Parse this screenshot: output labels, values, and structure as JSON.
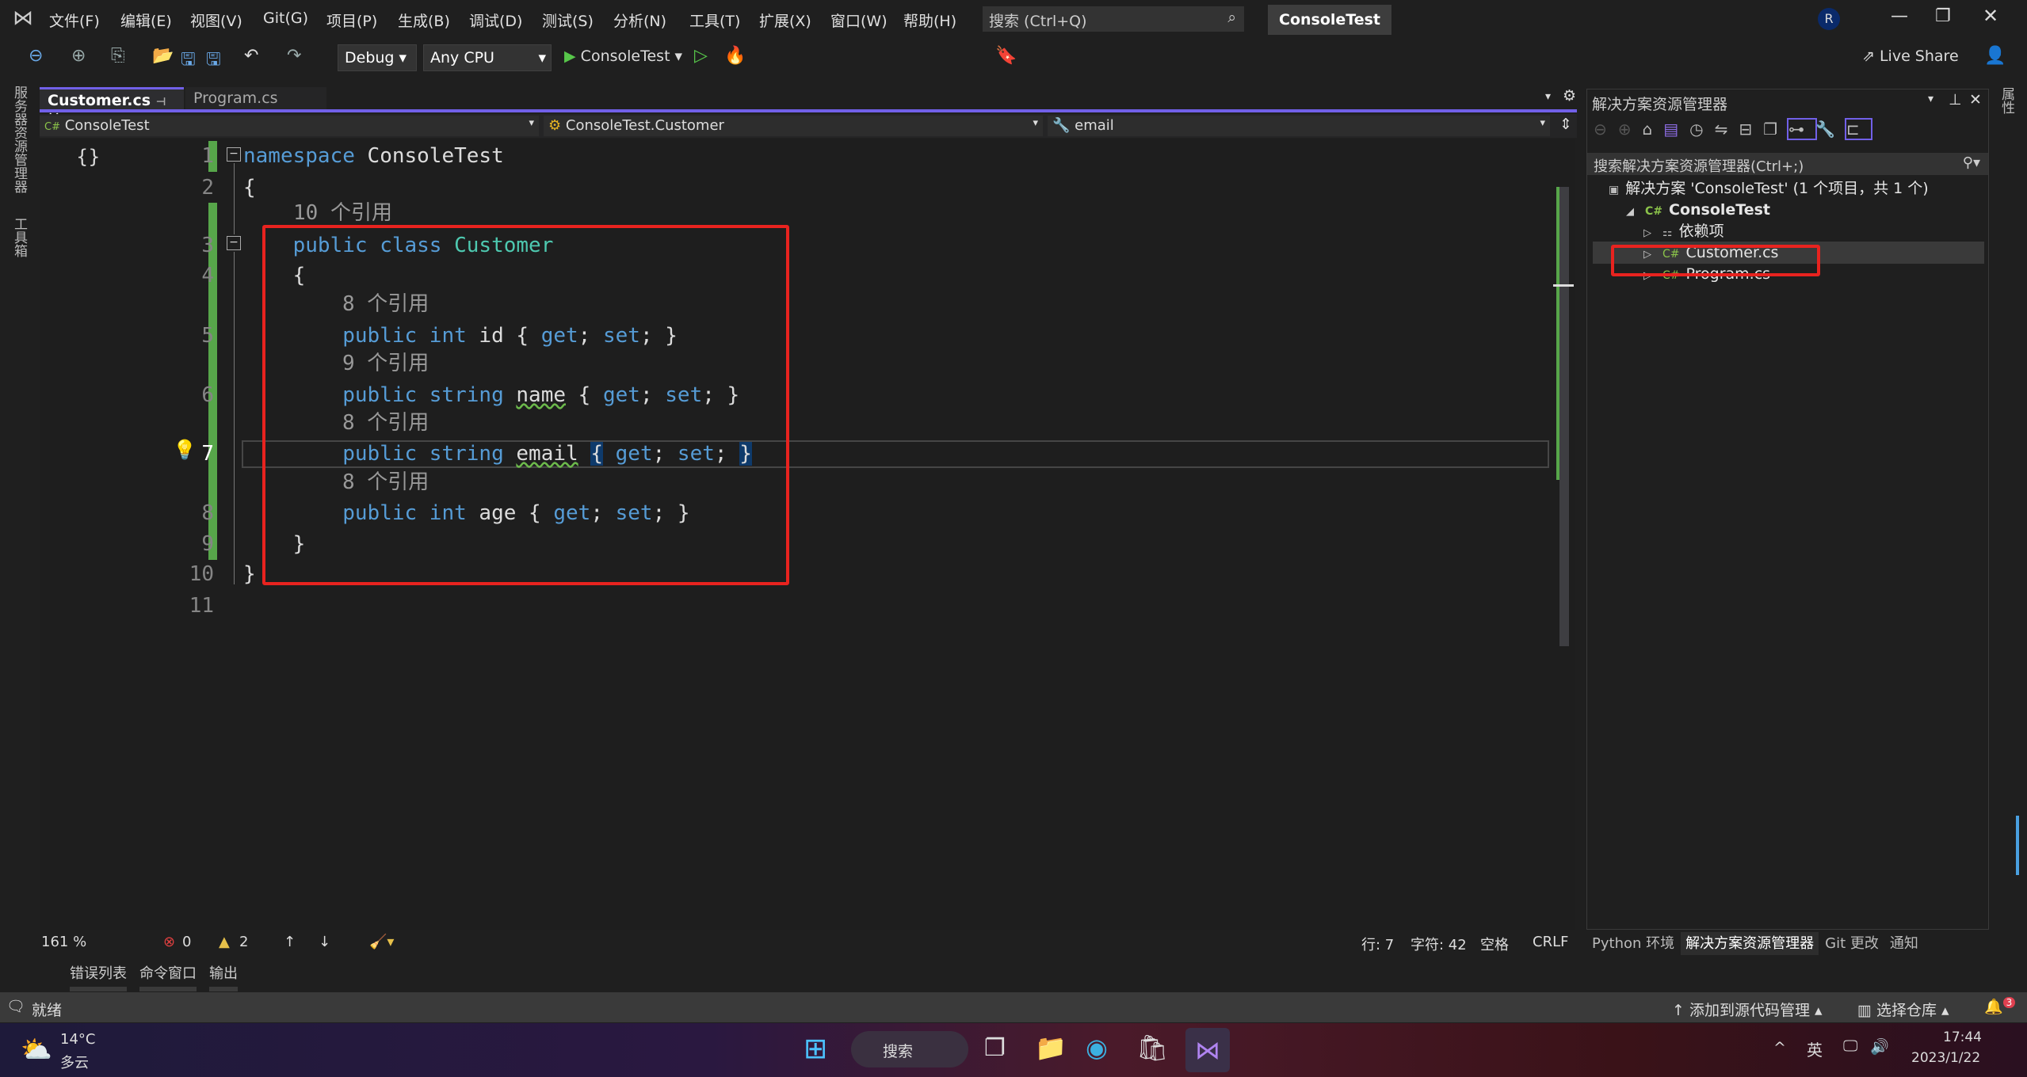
{
  "titlebar": {
    "menus": [
      "文件(F)",
      "编辑(E)",
      "视图(V)",
      "Git(G)",
      "项目(P)",
      "生成(B)",
      "调试(D)",
      "测试(S)",
      "分析(N)",
      "工具(T)",
      "扩展(X)",
      "窗口(W)",
      "帮助(H)"
    ],
    "search_placeholder": "搜索 (Ctrl+Q)",
    "project": "ConsoleTest",
    "avatar": "R"
  },
  "toolbar": {
    "config": "Debug",
    "platform": "Any CPU",
    "run_target": "ConsoleTest",
    "live_share": "Live Share"
  },
  "side_left": {
    "server_explorer": "服务器资源管理器",
    "toolbox": "工具箱"
  },
  "side_right": {
    "properties": "属性"
  },
  "tabs": [
    {
      "label": "Customer.cs",
      "active": true
    },
    {
      "label": "Program.cs",
      "active": false
    }
  ],
  "navbar": {
    "project": "ConsoleTest",
    "type": "ConsoleTest.Customer",
    "member": "email"
  },
  "editor": {
    "lines": [
      {
        "num": "1",
        "tokens": [
          [
            "kw",
            "namespace"
          ],
          [
            "pl",
            " ConsoleTest"
          ]
        ]
      },
      {
        "num": "2",
        "tokens": [
          [
            "pl",
            "{"
          ]
        ]
      },
      {
        "lens": "10 个引用"
      },
      {
        "num": "3",
        "tokens": [
          [
            "pl",
            "    "
          ],
          [
            "kw",
            "public class "
          ],
          [
            "ty",
            "Customer"
          ]
        ]
      },
      {
        "num": "4",
        "tokens": [
          [
            "pl",
            "    {"
          ]
        ]
      },
      {
        "lens": "8 个引用"
      },
      {
        "num": "5",
        "tokens": [
          [
            "pl",
            "        "
          ],
          [
            "kw",
            "public int "
          ],
          [
            "pl",
            "id { "
          ],
          [
            "kw",
            "get"
          ],
          [
            "pl",
            "; "
          ],
          [
            "kw",
            "set"
          ],
          [
            "pl",
            "; }"
          ]
        ]
      },
      {
        "lens": "9 个引用"
      },
      {
        "num": "6",
        "tokens": [
          [
            "pl",
            "        "
          ],
          [
            "kw",
            "public string "
          ],
          [
            "squig",
            "name"
          ],
          [
            "pl",
            " { "
          ],
          [
            "kw",
            "get"
          ],
          [
            "pl",
            "; "
          ],
          [
            "kw",
            "set"
          ],
          [
            "pl",
            "; }"
          ]
        ]
      },
      {
        "lens": "8 个引用"
      },
      {
        "num": "7",
        "current": true,
        "tokens": [
          [
            "pl",
            "        "
          ],
          [
            "kw",
            "public string "
          ],
          [
            "squig",
            "email"
          ],
          [
            "pl",
            " "
          ],
          [
            "brace-hl",
            "{"
          ],
          [
            "pl",
            " "
          ],
          [
            "kw",
            "get"
          ],
          [
            "pl",
            "; "
          ],
          [
            "kw",
            "set"
          ],
          [
            "pl",
            "; "
          ],
          [
            "brace-hl",
            "}"
          ]
        ]
      },
      {
        "lens": "8 个引用"
      },
      {
        "num": "8",
        "tokens": [
          [
            "pl",
            "        "
          ],
          [
            "kw",
            "public int "
          ],
          [
            "pl",
            "age { "
          ],
          [
            "kw",
            "get"
          ],
          [
            "pl",
            "; "
          ],
          [
            "kw",
            "set"
          ],
          [
            "pl",
            "; }"
          ]
        ]
      },
      {
        "num": "9",
        "tokens": [
          [
            "pl",
            "    }"
          ]
        ]
      },
      {
        "num": "10",
        "tokens": [
          [
            "pl",
            "}"
          ]
        ]
      },
      {
        "num": "11",
        "tokens": []
      }
    ]
  },
  "solution_explorer": {
    "title": "解决方案资源管理器",
    "search_placeholder": "搜索解决方案资源管理器(Ctrl+;)",
    "items": [
      {
        "label": "解决方案 'ConsoleTest' (1 个项目，共 1 个)",
        "icon": "solution-icon",
        "glyph": "▣",
        "indent": 0
      },
      {
        "label": "ConsoleTest",
        "icon": "csharp-project-icon",
        "glyph": "C#",
        "indent": 1,
        "bold": true,
        "expander": "◢"
      },
      {
        "label": "依赖项",
        "icon": "dependencies-icon",
        "glyph": "⚏",
        "indent": 2,
        "expander": "▷"
      },
      {
        "label": "Customer.cs",
        "icon": "csharp-file-icon",
        "glyph": "C#",
        "indent": 2,
        "expander": "▷",
        "selected": true
      },
      {
        "label": "Program.cs",
        "icon": "csharp-file-icon",
        "glyph": "C#",
        "indent": 2,
        "expander": "▷"
      }
    ],
    "bottom_tabs": [
      "Python 环境",
      "解决方案资源管理器",
      "Git 更改",
      "通知"
    ]
  },
  "editor_status": {
    "zoom": "161 %",
    "errors": "0",
    "warnings": "2",
    "line": "行: 7",
    "char": "字符: 42",
    "indent": "空格",
    "eol": "CRLF"
  },
  "bottom_tabs": [
    "错误列表",
    "命令窗口",
    "输出"
  ],
  "statusbar": {
    "ready": "就绪",
    "add_source": "添加到源代码管理",
    "select_repo": "选择仓库",
    "notifications": "3"
  },
  "taskbar": {
    "temp": "14°C",
    "weather": "多云",
    "search": "搜索",
    "time": "17:44",
    "date": "2023/1/22",
    "ime": "英"
  },
  "colors": {
    "accent": "#7160e8",
    "keyword": "#569cd6",
    "type": "#4ec9b0",
    "highlight_box": "#e8231f",
    "change_bar": "#57a64a"
  }
}
